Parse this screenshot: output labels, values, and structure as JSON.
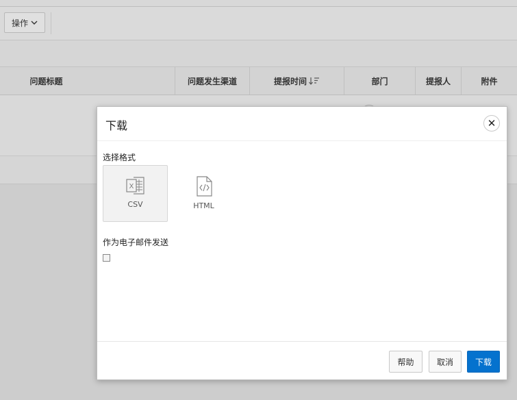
{
  "toolbar": {
    "actions_label": "操作"
  },
  "grid": {
    "columns": [
      {
        "label": "问题标题"
      },
      {
        "label": "问题发生渠道"
      },
      {
        "label": "提报时间"
      },
      {
        "label": "部门"
      },
      {
        "label": "提报人"
      },
      {
        "label": "附件"
      }
    ]
  },
  "dialog": {
    "title": "下载",
    "format_label": "选择格式",
    "formats": [
      {
        "label": "CSV",
        "icon": "excel-file-icon",
        "selected": true
      },
      {
        "label": "HTML",
        "icon": "code-file-icon",
        "selected": false
      }
    ],
    "email_label": "作为电子邮件发送",
    "email_checked": false,
    "buttons": {
      "help": "帮助",
      "cancel": "取消",
      "download": "下载"
    }
  },
  "colors": {
    "primary": "#0572ce",
    "backdrop": "#d2d2d2",
    "dialog_bg": "#ffffff"
  }
}
